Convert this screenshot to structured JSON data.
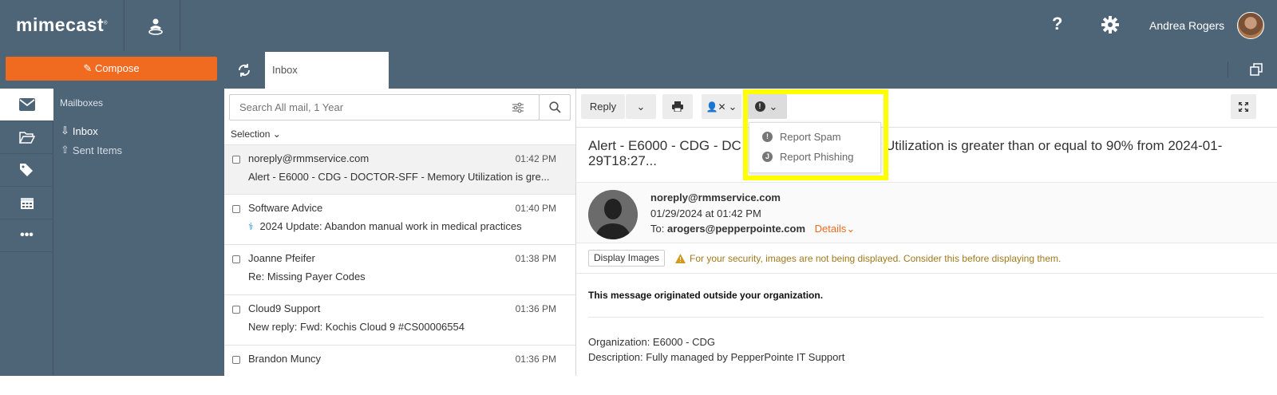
{
  "app": {
    "logo": "mimecast",
    "logo_mark": "®",
    "user_name": "Andrea Rogers",
    "help_label": "?"
  },
  "left": {
    "compose_label": "Compose",
    "mailboxes_title": "Mailboxes",
    "mailboxes": [
      {
        "label": "Inbox"
      },
      {
        "label": "Sent Items"
      }
    ],
    "rail_icons": [
      "envelope-icon",
      "folder-open-icon",
      "tags-icon",
      "calendar-icon",
      "more-icon"
    ]
  },
  "tabs": {
    "inbox_label": "Inbox"
  },
  "search": {
    "placeholder": "Search All mail, 1 Year"
  },
  "list": {
    "selection_label": "Selection",
    "messages": [
      {
        "sender": "noreply@rmmservice.com",
        "time": "01:42 PM",
        "subject": "Alert - E6000 - CDG - DOCTOR-SFF - Memory Utilization is gre..."
      },
      {
        "sender": "Software Advice",
        "time": "01:40 PM",
        "subject": "2024 Update: Abandon manual work in medical practices"
      },
      {
        "sender": "Joanne Pfeifer",
        "time": "01:38 PM",
        "subject": "Re: Missing Payer Codes"
      },
      {
        "sender": "Cloud9 Support",
        "time": "01:36 PM",
        "subject": "New reply: Fwd: Kochis Cloud 9 #CS00006554"
      },
      {
        "sender": "Brandon Muncy",
        "time": "01:36 PM",
        "subject": ""
      }
    ]
  },
  "reader": {
    "reply_label": "Reply",
    "subject_start": "Alert - E6000 - CDG - DC",
    "subject_end": "y Utilization is greater than or equal to 90% from 2024-01-29T18:27...",
    "from": "noreply@rmmservice.com",
    "date": "01/29/2024 at 01:42 PM",
    "to_label": "To:",
    "to": "arogers@pepperpointe.com",
    "details_label": "Details",
    "display_images_label": "Display Images",
    "security_warning": "For your security, images are not being displayed. Consider this before displaying them.",
    "external_notice": "This message originated outside your organization.",
    "body_lines": [
      "Organization: E6000 - CDG",
      "Description: Fully managed by PepperPointe IT Support"
    ]
  },
  "report_menu": {
    "items": [
      {
        "label": "Report Spam"
      },
      {
        "label": "Report Phishing"
      }
    ]
  },
  "colors": {
    "topbar": "#4e6578",
    "accent": "#f06a20",
    "highlight": "#ffff00"
  }
}
